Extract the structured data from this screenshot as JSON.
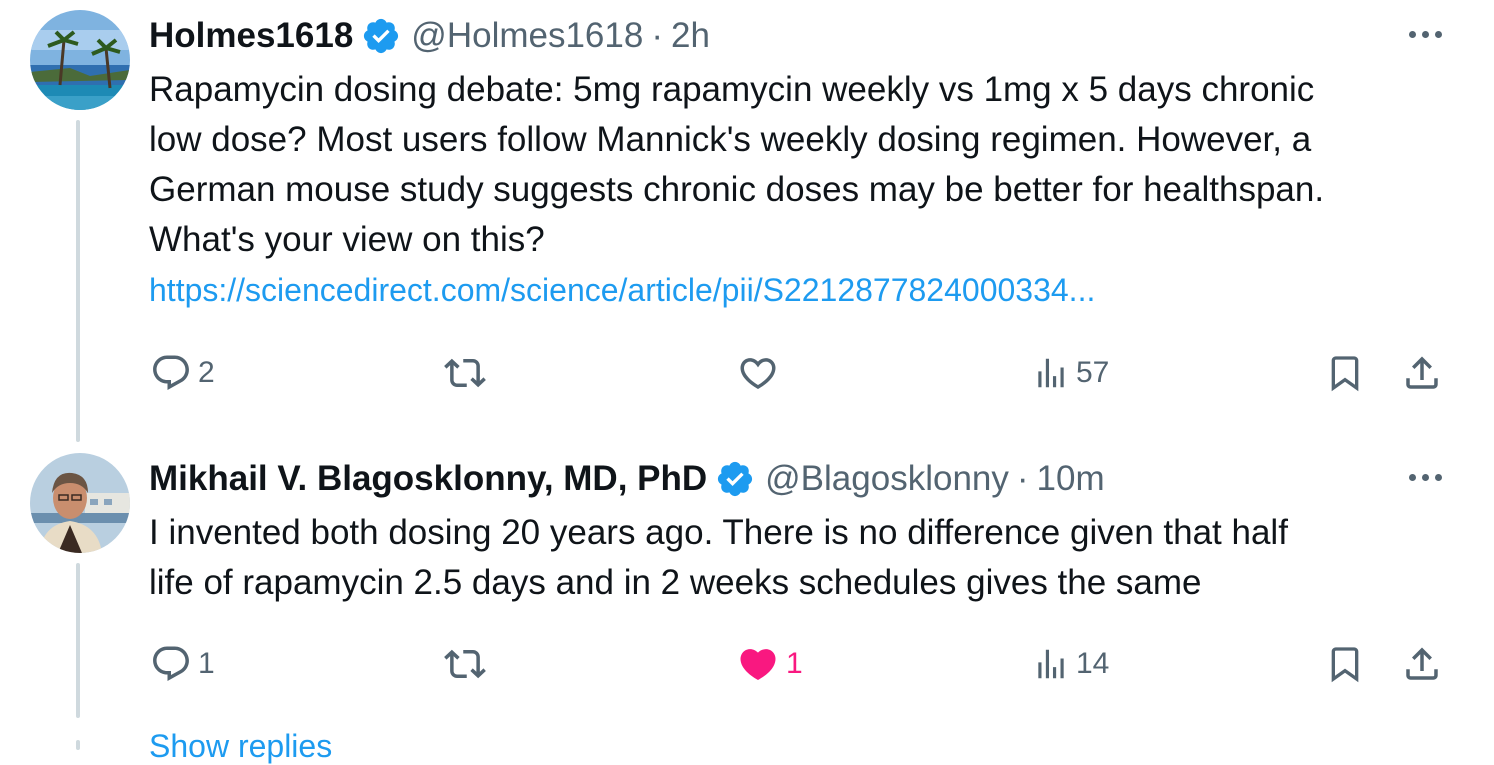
{
  "tweets": [
    {
      "name": "Holmes1618",
      "handle": "@Holmes1618",
      "separator": "·",
      "time": "2h",
      "text_lines": [
        "Rapamycin dosing debate: 5mg rapamycin weekly vs 1mg x 5 days chronic",
        "low dose? Most users follow Mannick's weekly dosing regimen. However, a",
        "German mouse study suggests chronic doses may be better for healthspan.",
        "What's your view on this?"
      ],
      "link": "https://sciencedirect.com/science/article/pii/S2212877824000334...",
      "replies": "2",
      "retweets": "",
      "likes": "",
      "views": "57",
      "liked": false,
      "avatar_icon": "beach-palm-avatar"
    },
    {
      "name": "Mikhail V. Blagosklonny, MD, PhD",
      "handle": "@Blagosklonny",
      "separator": "·",
      "time": "10m",
      "text_lines": [
        "I invented both dosing 20 years ago. There is no difference given that half",
        "life of rapamycin 2.5 days and in 2 weeks schedules gives the same"
      ],
      "replies": "1",
      "retweets": "",
      "likes": "1",
      "views": "14",
      "liked": true,
      "avatar_icon": "man-portrait-avatar"
    }
  ],
  "show_more_label": "Show replies",
  "colors": {
    "text": "#0f1419",
    "secondary": "#536471",
    "link": "#1d9bf0",
    "like": "#f91880",
    "verified": "#1d9bf0",
    "thread_line": "#cfd9de"
  }
}
